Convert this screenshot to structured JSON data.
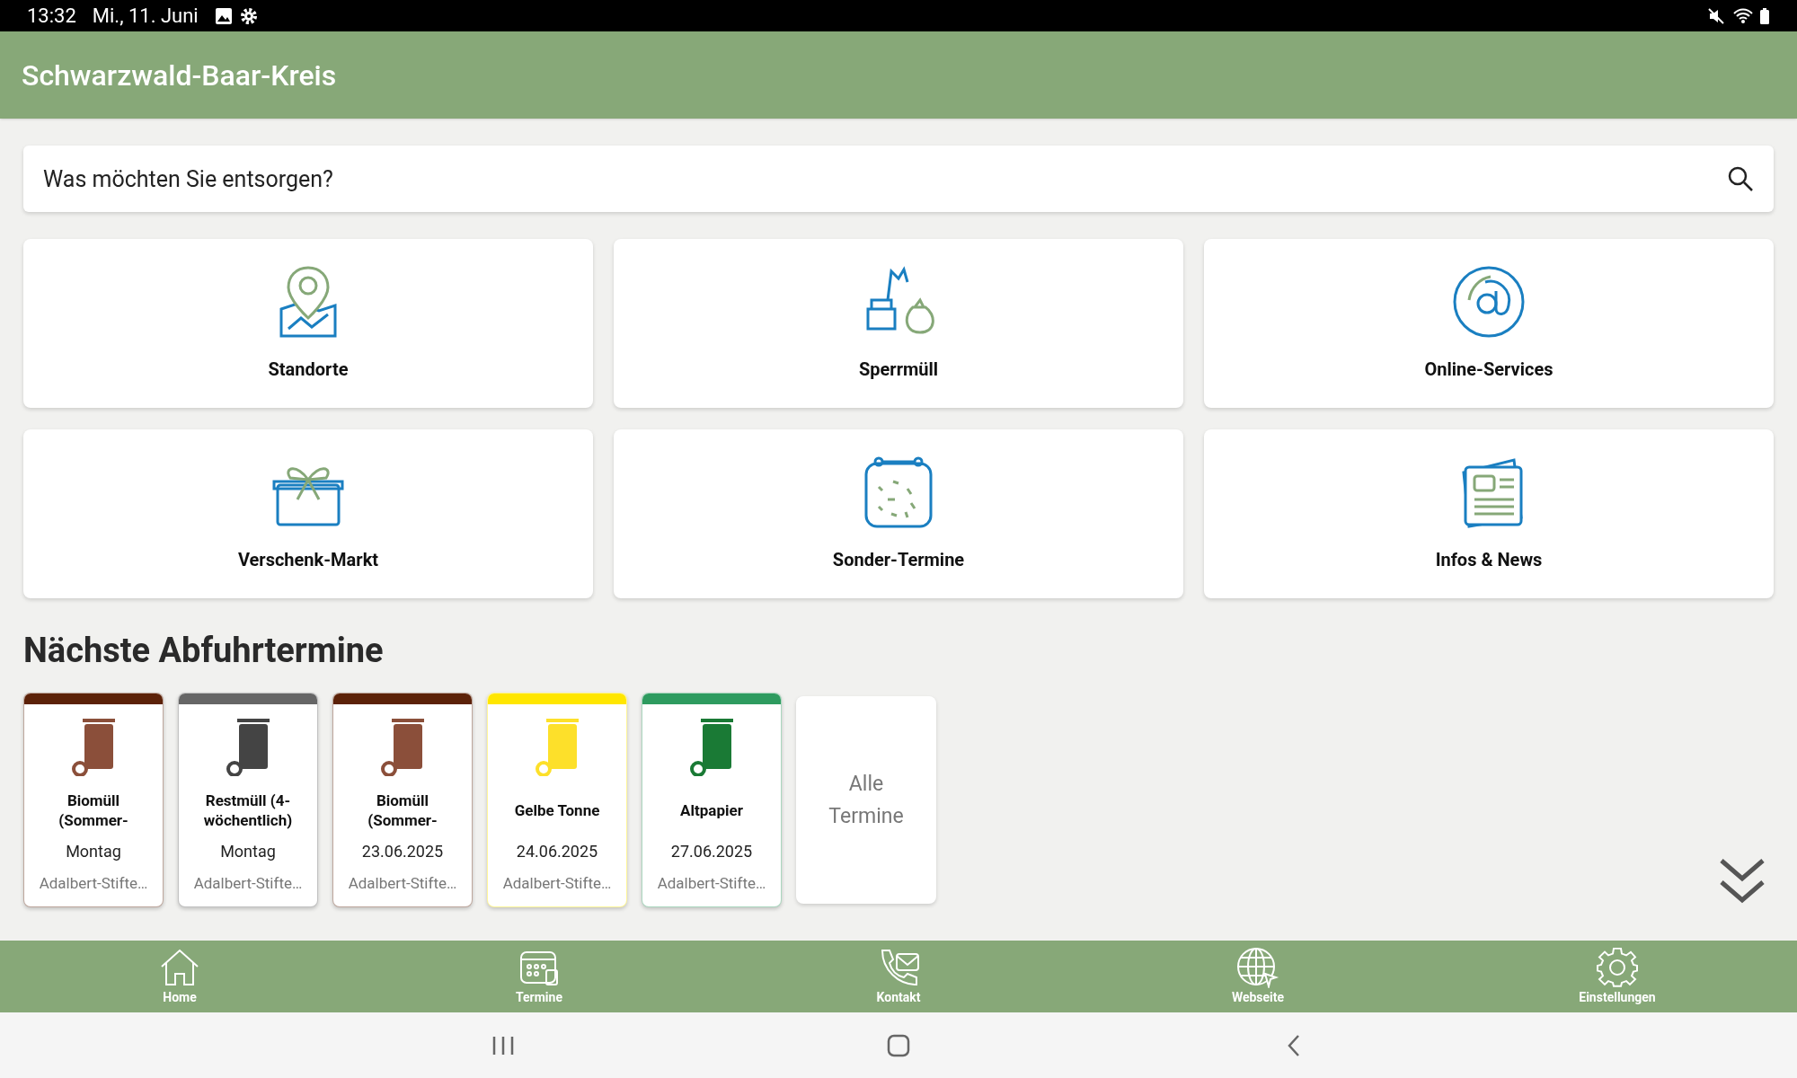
{
  "status_bar": {
    "time": "13:32",
    "date": "Mi., 11. Juni"
  },
  "header": {
    "title": "Schwarzwald-Baar-Kreis"
  },
  "search": {
    "placeholder": "Was möchten Sie entsorgen?"
  },
  "tiles": [
    {
      "kind": "location",
      "label": "Standorte"
    },
    {
      "kind": "bulky",
      "label": "Sperrmüll"
    },
    {
      "kind": "at",
      "label": "Online-Services"
    },
    {
      "kind": "gift",
      "label": "Verschenk-Markt"
    },
    {
      "kind": "calendar",
      "label": "Sonder-Termine"
    },
    {
      "kind": "news",
      "label": "Infos & News"
    }
  ],
  "section_title": "Nächste Abfuhrtermine",
  "pickups": [
    {
      "title": "Biomüll (Sommer-",
      "date": "Montag",
      "location": "Adalbert-Stifte…",
      "color": "#5c2209"
    },
    {
      "title": "Restmüll (4-wöchentlich)",
      "date": "Montag",
      "location": "Adalbert-Stifte…",
      "color": "#666666"
    },
    {
      "title": "Biomüll (Sommer-",
      "date": "23.06.2025",
      "location": "Adalbert-Stifte…",
      "color": "#5c2209"
    },
    {
      "title": "Gelbe Tonne",
      "date": "24.06.2025",
      "location": "Adalbert-Stifte…",
      "color": "#ffe600"
    },
    {
      "title": "Altpapier",
      "date": "27.06.2025",
      "location": "Adalbert-Stifte…",
      "color": "#2e9b5f"
    }
  ],
  "all_dates": "Alle Termine",
  "bottom_nav": [
    {
      "kind": "home",
      "label": "Home"
    },
    {
      "kind": "calendar",
      "label": "Termine"
    },
    {
      "kind": "phone",
      "label": "Kontakt"
    },
    {
      "kind": "globe",
      "label": "Webseite"
    },
    {
      "kind": "gear",
      "label": "Einstellungen"
    }
  ]
}
